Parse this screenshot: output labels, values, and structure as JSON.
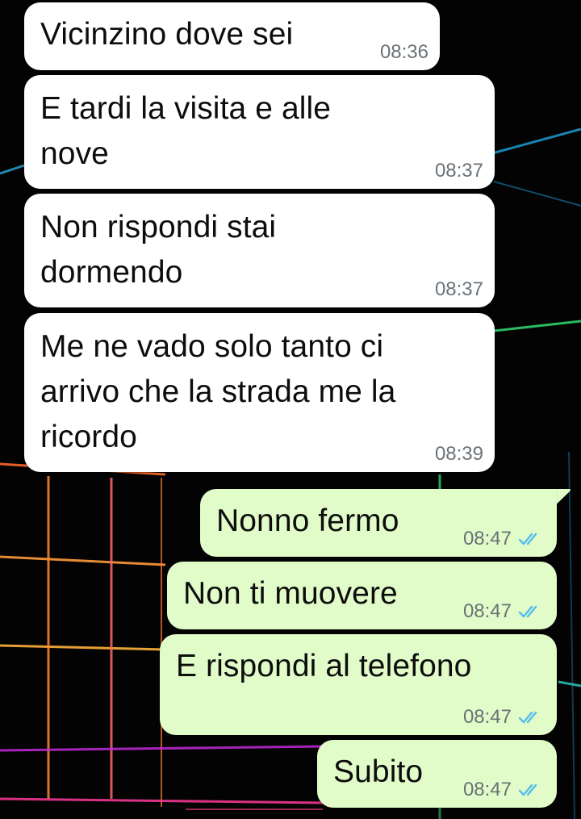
{
  "messages": [
    {
      "direction": "incoming",
      "text": "Vicinzino dove sei",
      "time": "08:36"
    },
    {
      "direction": "incoming",
      "text": "E tardi la visita e alle\nnove",
      "time": "08:37"
    },
    {
      "direction": "incoming",
      "text": "Non rispondi stai\ndormendo",
      "time": "08:37"
    },
    {
      "direction": "incoming",
      "text": "Me ne vado solo tanto ci\narrivo che la strada me la\nricordo",
      "time": "08:39"
    },
    {
      "direction": "outgoing",
      "text": "Nonno fermo",
      "time": "08:47",
      "status_icon": "double-check-icon"
    },
    {
      "direction": "outgoing",
      "text": "Non ti muovere",
      "time": "08:47",
      "status_icon": "double-check-icon"
    },
    {
      "direction": "outgoing",
      "text": "E rispondi al telefono",
      "time": "08:47",
      "status_icon": "double-check-icon"
    },
    {
      "direction": "outgoing",
      "text": "Subito",
      "time": "08:47",
      "status_icon": "double-check-icon"
    }
  ],
  "colors": {
    "incoming_bubble": "#ffffff",
    "outgoing_bubble": "#e1fbc9",
    "read_ticks": "#53bdeb",
    "timestamp": "#6a7277"
  }
}
